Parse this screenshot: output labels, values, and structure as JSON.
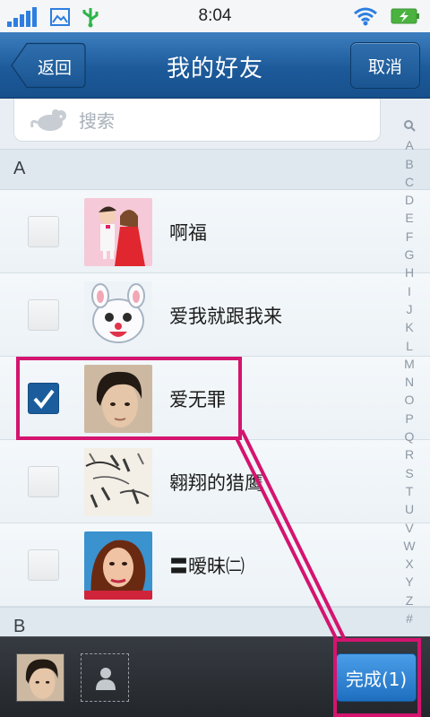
{
  "status_bar": {
    "time": "8:04"
  },
  "header": {
    "back_label": "返回",
    "title": "我的好友",
    "cancel_label": "取消"
  },
  "search": {
    "placeholder": "搜索"
  },
  "sections": [
    {
      "letter": "A"
    },
    {
      "letter": "B"
    }
  ],
  "contacts": [
    {
      "name": "啊福",
      "checked": false
    },
    {
      "name": "爱我就跟我来",
      "checked": false
    },
    {
      "name": "爱无罪",
      "checked": true
    },
    {
      "name": "翱翔的猎鹰",
      "checked": false
    },
    {
      "name": "〓暧昧㈡",
      "checked": false
    }
  ],
  "alphabet_index": [
    "Q",
    "A",
    "B",
    "C",
    "D",
    "E",
    "F",
    "G",
    "H",
    "I",
    "J",
    "K",
    "L",
    "M",
    "N",
    "O",
    "P",
    "Q",
    "R",
    "S",
    "T",
    "U",
    "V",
    "W",
    "X",
    "Y",
    "Z",
    "#"
  ],
  "bottom_bar": {
    "done_label": "完成(1)"
  },
  "colors": {
    "header_blue": "#1d5a9a",
    "highlight": "#d4146f",
    "checked_blue": "#1b5d9c"
  }
}
